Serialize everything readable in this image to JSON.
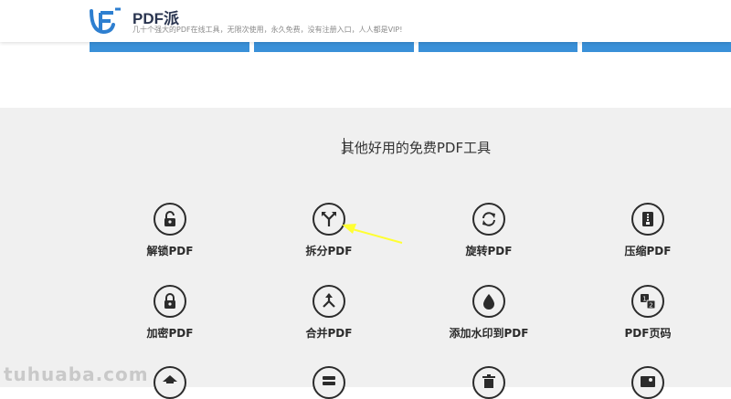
{
  "header": {
    "brand": "PDF派",
    "tagline": "几十个强大的PDF在线工具，无限次使用，永久免费，没有注册入口，人人都是VIP!"
  },
  "section": {
    "title": "其他好用的免费PDF工具"
  },
  "tools": [
    {
      "label": "解锁PDF",
      "icon": "unlock-icon"
    },
    {
      "label": "拆分PDF",
      "icon": "split-icon"
    },
    {
      "label": "旋转PDF",
      "icon": "rotate-icon"
    },
    {
      "label": "压缩PDF",
      "icon": "compress-icon"
    },
    {
      "label": "加密PDF",
      "icon": "lock-icon"
    },
    {
      "label": "合并PDF",
      "icon": "merge-icon"
    },
    {
      "label": "添加水印到PDF",
      "icon": "watermark-icon"
    },
    {
      "label": "PDF页码",
      "icon": "page-number-icon"
    },
    {
      "label": "",
      "icon": "inbox-icon"
    },
    {
      "label": "",
      "icon": "list-icon"
    },
    {
      "label": "",
      "icon": "trash-icon"
    },
    {
      "label": "",
      "icon": "image-icon"
    }
  ],
  "watermark": "tuhuaba.com",
  "colors": {
    "accent": "#3a90d8",
    "section_bg": "#f0f0f0",
    "icon": "#2b2b2b",
    "arrow": "#ffff33"
  }
}
